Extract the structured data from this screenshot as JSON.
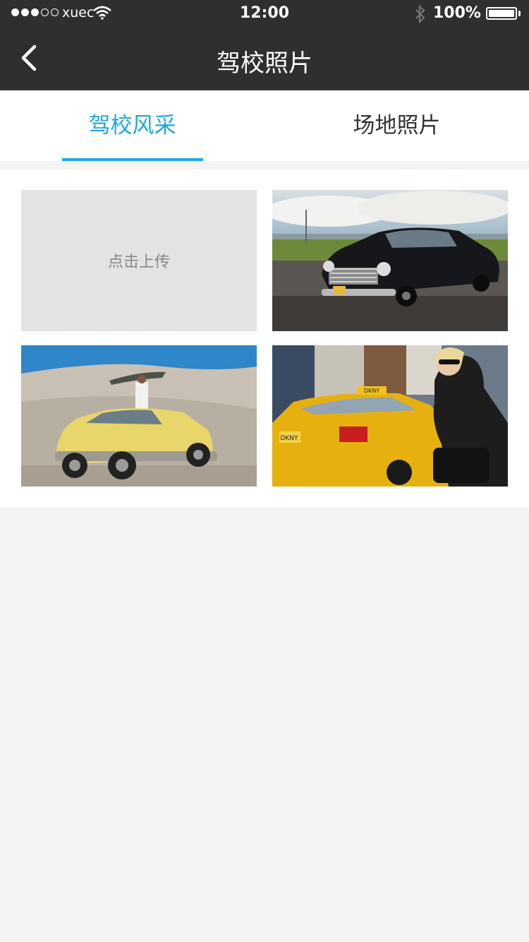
{
  "status_bar": {
    "carrier": "xuec",
    "time": "12:00",
    "battery": "100%"
  },
  "nav": {
    "title": "驾校照片",
    "back_icon": "chevron-left-icon"
  },
  "tabs": [
    {
      "label": "驾校风采",
      "active": true
    },
    {
      "label": "场地照片",
      "active": false
    }
  ],
  "gallery": {
    "upload_label": "点击上传",
    "photos": [
      {
        "plate": ""
      },
      {
        "plate": ""
      },
      {
        "plate": "DKNY"
      }
    ]
  },
  "colors": {
    "accent": "#1ea6e6",
    "header_bg": "#2f2f2f",
    "page_bg": "#f4f4f4"
  }
}
